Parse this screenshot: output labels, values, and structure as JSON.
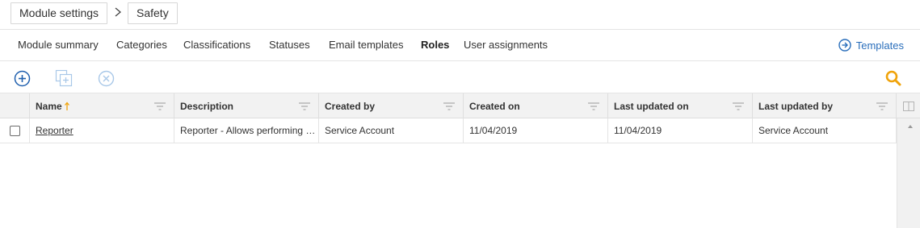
{
  "breadcrumb": {
    "items": [
      {
        "label": "Module settings"
      },
      {
        "label": "Safety"
      }
    ]
  },
  "tabs": [
    {
      "label": "Module summary",
      "active": false
    },
    {
      "label": "Categories",
      "active": false
    },
    {
      "label": "Classifications",
      "active": false
    },
    {
      "label": "Statuses",
      "active": false
    },
    {
      "label": "Email templates",
      "active": false
    },
    {
      "label": "Roles",
      "active": true
    },
    {
      "label": "User assignments",
      "active": false
    }
  ],
  "templates_link": {
    "label": "Templates",
    "icon": "arrow-circle-right-icon"
  },
  "toolbar": {
    "add_icon": "plus-circle-icon",
    "copy_icon": "copy-add-icon",
    "cancel_icon": "x-circle-icon",
    "search_icon": "search-icon"
  },
  "grid": {
    "columns": [
      {
        "label": "Name",
        "sort": "asc"
      },
      {
        "label": "Description"
      },
      {
        "label": "Created by"
      },
      {
        "label": "Created on"
      },
      {
        "label": "Last updated on"
      },
      {
        "label": "Last updated by"
      }
    ],
    "rows": [
      {
        "name": "Reporter",
        "description": "Reporter - Allows performing actions",
        "created_by": "Service Account",
        "created_on": "11/04/2019",
        "last_updated_on": "11/04/2019",
        "last_updated_by": "Service Account"
      }
    ]
  },
  "colors": {
    "accent_blue": "#2a6ebb",
    "search_orange": "#f0a30a",
    "disabled_icon": "#9dc3e6"
  }
}
